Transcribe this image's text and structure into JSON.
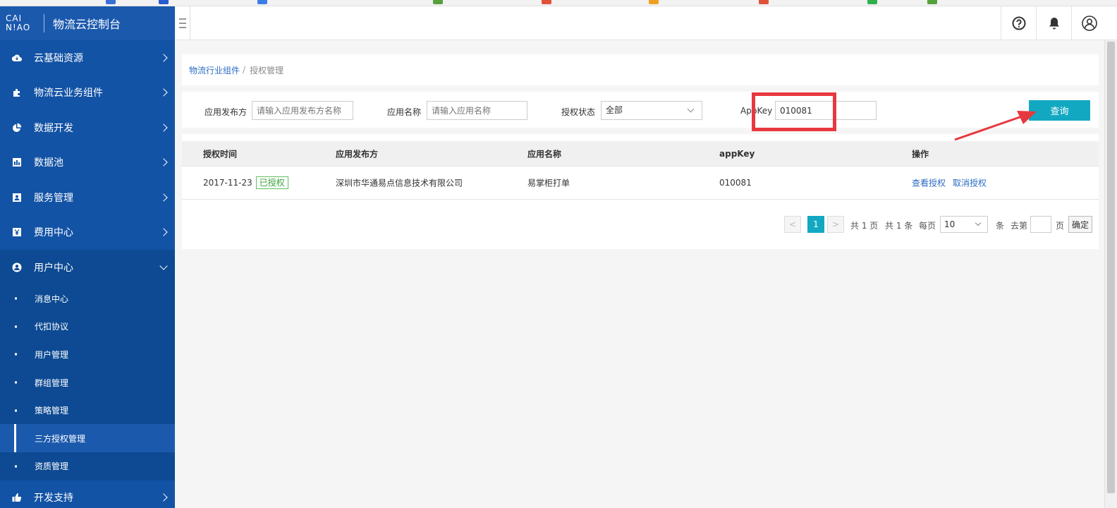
{
  "sidebar": {
    "logo_line1": "CAI",
    "logo_line2": "N!AO",
    "title": "物流云控制台",
    "groups_top": [
      {
        "label": "云基础资源"
      },
      {
        "label": "物流云业务组件"
      },
      {
        "label": "数据开发"
      },
      {
        "label": "数据池"
      },
      {
        "label": "服务管理"
      },
      {
        "label": "费用中心"
      }
    ],
    "open_group": {
      "label": "用户中心"
    },
    "sub_items": [
      {
        "label": "消息中心"
      },
      {
        "label": "代扣协议"
      },
      {
        "label": "用户管理"
      },
      {
        "label": "群组管理"
      },
      {
        "label": "策略管理"
      },
      {
        "label": "三方授权管理"
      },
      {
        "label": "资质管理"
      }
    ],
    "bottom_group": {
      "label": "开发支持"
    }
  },
  "header": {
    "icons": [
      "help-icon",
      "bell-icon",
      "user-icon"
    ]
  },
  "breadcrumb": {
    "parent": "物流行业组件",
    "separator": "/",
    "current": "授权管理"
  },
  "filters": {
    "publisher_label": "应用发布方",
    "publisher_placeholder": "请输入应用发布方名称",
    "app_name_label": "应用名称",
    "app_name_placeholder": "请输入应用名称",
    "status_label": "授权状态",
    "status_value": "全部",
    "appkey_label": "AppKey",
    "appkey_value": "010081",
    "query_button": "查询"
  },
  "table": {
    "columns": [
      "授权时间",
      "应用发布方",
      "应用名称",
      "appKey",
      "操作"
    ],
    "rows": [
      {
        "date": "2017-11-23",
        "status": "已授权",
        "publisher": "深圳市华通易点信息技术有限公司",
        "app_name": "易掌柜打单",
        "appkey": "010081",
        "action_view": "查看授权",
        "action_cancel": "取消授权"
      }
    ]
  },
  "pagination": {
    "prev": "<",
    "current_page": "1",
    "next": ">",
    "total_pages_text": "共 1 页",
    "total_items_text": "共 1 条",
    "per_page_label": "每页",
    "per_page_value": "10",
    "per_page_unit": "条",
    "goto_label": "去第",
    "goto_unit": "页",
    "confirm": "确定"
  },
  "colors": {
    "sidebar_bg": "#0d4a93",
    "sidebar_group_bg": "#1353a5",
    "accent": "#13a8c2",
    "link": "#2b6cc4",
    "highlight": "#e8383f",
    "status_green": "#3aa23a"
  }
}
